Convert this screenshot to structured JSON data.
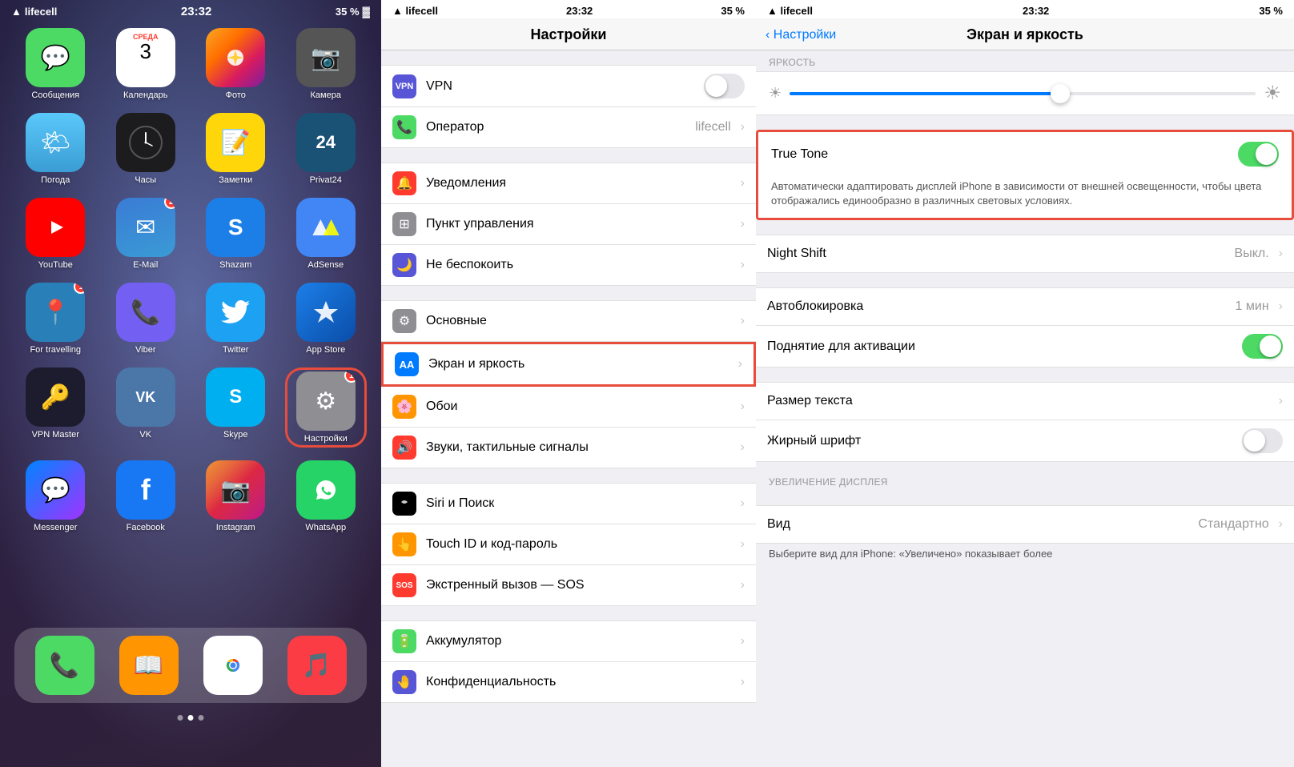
{
  "panel1": {
    "status": {
      "carrier": "lifecell",
      "signal": "📶",
      "wifi": "wifi",
      "time": "23:32",
      "battery": "35 %",
      "battery_icon": "🔋"
    },
    "apps": [
      {
        "id": "messages",
        "label": "Сообщения",
        "color": "app-messages",
        "icon": "💬",
        "badge": null
      },
      {
        "id": "calendar",
        "label": "Календарь",
        "color": "app-calendar",
        "icon": "calendar",
        "badge": null
      },
      {
        "id": "photos",
        "label": "Фото",
        "color": "app-photos",
        "icon": "🌸",
        "badge": null
      },
      {
        "id": "camera",
        "label": "Камера",
        "color": "app-camera",
        "icon": "📷",
        "badge": null
      },
      {
        "id": "weather",
        "label": "Погода",
        "color": "app-weather",
        "icon": "🌤",
        "badge": null
      },
      {
        "id": "clock",
        "label": "Часы",
        "color": "app-clock",
        "icon": "🕙",
        "badge": null
      },
      {
        "id": "notes",
        "label": "Заметки",
        "color": "app-notes",
        "icon": "📝",
        "badge": null
      },
      {
        "id": "privat24",
        "label": "Privat24",
        "color": "app-privat",
        "icon": "24",
        "badge": null
      },
      {
        "id": "youtube",
        "label": "YouTube",
        "color": "app-youtube",
        "icon": "▶",
        "badge": null
      },
      {
        "id": "email",
        "label": "E-Mail",
        "color": "app-email",
        "icon": "✉",
        "badge": "2"
      },
      {
        "id": "shazam",
        "label": "Shazam",
        "color": "app-shazam",
        "icon": "S",
        "badge": null
      },
      {
        "id": "adsense",
        "label": "AdSense",
        "color": "app-adsense",
        "icon": "A",
        "badge": null
      },
      {
        "id": "travelling",
        "label": "For travelling",
        "color": "app-travelling",
        "icon": "📍",
        "badge": "1"
      },
      {
        "id": "viber",
        "label": "Viber",
        "color": "app-viber",
        "icon": "📞",
        "badge": null
      },
      {
        "id": "twitter",
        "label": "Twitter",
        "color": "app-twitter",
        "icon": "🐦",
        "badge": null
      },
      {
        "id": "appstore",
        "label": "App Store",
        "color": "app-appstore",
        "icon": "A",
        "badge": null
      },
      {
        "id": "vpn",
        "label": "VPN Master",
        "color": "app-vpn",
        "icon": "🔑",
        "badge": null
      },
      {
        "id": "vk",
        "label": "VK",
        "color": "app-vk",
        "icon": "VK",
        "badge": null
      },
      {
        "id": "skype",
        "label": "Skype",
        "color": "app-skype",
        "icon": "S",
        "badge": null
      },
      {
        "id": "settings",
        "label": "Настройки",
        "color": "app-settings",
        "icon": "⚙",
        "badge": "1",
        "highlight": true
      },
      {
        "id": "messenger",
        "label": "Messenger",
        "color": "app-messenger",
        "icon": "💬",
        "badge": null
      },
      {
        "id": "facebook",
        "label": "Facebook",
        "color": "app-facebook",
        "icon": "f",
        "badge": null
      },
      {
        "id": "instagram",
        "label": "Instagram",
        "color": "app-instagram",
        "icon": "📷",
        "badge": null
      },
      {
        "id": "whatsapp",
        "label": "WhatsApp",
        "color": "app-whatsapp",
        "icon": "📱",
        "badge": null
      }
    ],
    "dock": [
      {
        "id": "phone",
        "label": "Телефон",
        "color": "#4cd964",
        "icon": "📞"
      },
      {
        "id": "books",
        "label": "Книги",
        "color": "#ff9500",
        "icon": "📖"
      },
      {
        "id": "chrome",
        "label": "Chrome",
        "color": "#4285f4",
        "icon": "🌐"
      },
      {
        "id": "music",
        "label": "Музыка",
        "color": "#fc3c44",
        "icon": "🎵"
      }
    ],
    "calendar_month": "Среда",
    "calendar_day": "3"
  },
  "panel2": {
    "status": {
      "carrier": "lifecell",
      "time": "23:32",
      "battery": "35 %"
    },
    "title": "Настройки",
    "rows": [
      {
        "id": "vpn",
        "label": "VPN",
        "icon_color": "#5856d6",
        "icon": "VPN",
        "value": "",
        "toggle": true,
        "toggle_on": false
      },
      {
        "id": "operator",
        "label": "Оператор",
        "icon_color": "#4cd964",
        "icon": "📞",
        "value": "lifecell",
        "has_chevron": true
      },
      {
        "id": "notifications",
        "label": "Уведомления",
        "icon_color": "#ff3b30",
        "icon": "🔔",
        "value": "",
        "has_chevron": true
      },
      {
        "id": "control_center",
        "label": "Пункт управления",
        "icon_color": "#8e8e93",
        "icon": "⊞",
        "value": "",
        "has_chevron": true
      },
      {
        "id": "do_not_disturb",
        "label": "Не беспокоить",
        "icon_color": "#5856d6",
        "icon": "🌙",
        "value": "",
        "has_chevron": true
      },
      {
        "id": "general",
        "label": "Основные",
        "icon_color": "#8e8e93",
        "icon": "⚙",
        "value": "",
        "has_chevron": true
      },
      {
        "id": "display",
        "label": "Экран и яркость",
        "icon_color": "#007aff",
        "icon": "AA",
        "value": "",
        "has_chevron": true,
        "highlight": true
      },
      {
        "id": "wallpaper",
        "label": "Обои",
        "icon_color": "#ff9500",
        "icon": "🌸",
        "value": "",
        "has_chevron": true
      },
      {
        "id": "sounds",
        "label": "Звуки, тактильные сигналы",
        "icon_color": "#ff3b30",
        "icon": "🔊",
        "value": "",
        "has_chevron": true
      },
      {
        "id": "siri",
        "label": "Siri и Поиск",
        "icon_color": "#000",
        "icon": "S",
        "value": "",
        "has_chevron": true
      },
      {
        "id": "touchid",
        "label": "Touch ID и код-пароль",
        "icon_color": "#ff9500",
        "icon": "👆",
        "value": "",
        "has_chevron": true
      },
      {
        "id": "sos",
        "label": "Экстренный вызов — SOS",
        "icon_color": "#ff3b30",
        "icon": "SOS",
        "value": "",
        "has_chevron": true
      },
      {
        "id": "battery",
        "label": "Аккумулятор",
        "icon_color": "#4cd964",
        "icon": "🔋",
        "value": "",
        "has_chevron": true
      },
      {
        "id": "privacy",
        "label": "Конфиденциальность",
        "icon_color": "#5856d6",
        "icon": "🤚",
        "value": "",
        "has_chevron": true
      }
    ]
  },
  "panel3": {
    "status": {
      "carrier": "lifecell",
      "time": "23:32",
      "battery": "35 %"
    },
    "back_label": "Настройки",
    "title": "Экран и яркость",
    "brightness_section": "ЯРКОСТЬ",
    "true_tone": {
      "label": "True Tone",
      "enabled": true,
      "description": "Автоматически адаптировать дисплей iPhone в зависимости от внешней освещенности, чтобы цвета отображались единообразно в различных световых условиях."
    },
    "rows": [
      {
        "id": "night_shift",
        "label": "Night Shift",
        "value": "Выкл.",
        "has_chevron": true
      },
      {
        "id": "auto_lock",
        "label": "Автоблокировка",
        "value": "1 мин",
        "has_chevron": true
      },
      {
        "id": "raise_to_wake",
        "label": "Поднятие для активации",
        "value": "",
        "toggle": true,
        "toggle_on": true
      },
      {
        "id": "text_size",
        "label": "Размер текста",
        "value": "",
        "has_chevron": true
      },
      {
        "id": "bold",
        "label": "Жирный шрифт",
        "value": "",
        "toggle": true,
        "toggle_on": false
      }
    ],
    "zoom_section": "УВЕЛИЧЕНИЕ ДИСПЛЕЯ",
    "zoom_rows": [
      {
        "id": "view",
        "label": "Вид",
        "value": "Стандартно",
        "has_chevron": true
      }
    ],
    "zoom_desc": "Выберите вид для iPhone: «Увеличено» показывает более"
  }
}
